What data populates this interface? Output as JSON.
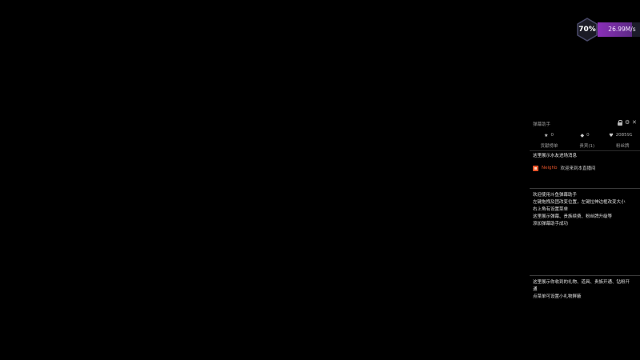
{
  "network_widget": {
    "percent": "70%",
    "speed": "26.99M/s",
    "usage_fraction": 0.7,
    "accent_color": "#8a2fb8"
  },
  "panel": {
    "title": "弹幕助手",
    "icons": [
      "lock-icon",
      "gear-icon",
      "close-icon"
    ],
    "stats": [
      {
        "icon": "star-icon",
        "value": "0"
      },
      {
        "icon": "fish-ball-icon",
        "value": "0"
      },
      {
        "icon": "heart-icon",
        "value": "208591"
      }
    ],
    "tabs": [
      "贡献榜单",
      "贵宾(1)",
      "粉丝牌"
    ],
    "entrance_heading": "这里展示水友进场消息",
    "welcome": {
      "user": "Neighb",
      "text": "欢迎来到本直播间"
    },
    "help_lines": [
      "欢迎使用斗鱼弹幕助手",
      "左键拖拽及团改变位置，左键拉伸边框改变大小",
      "右上角有设置菜单",
      "这里展示弹幕、贵族续费、粉丝牌升级等",
      "添加弹幕助手成功"
    ],
    "gift_lines": [
      "这里展示你收到的礼物、道具、贵族开通、钻粉开",
      "通",
      "点菜单可设置小礼物屏蔽"
    ]
  }
}
